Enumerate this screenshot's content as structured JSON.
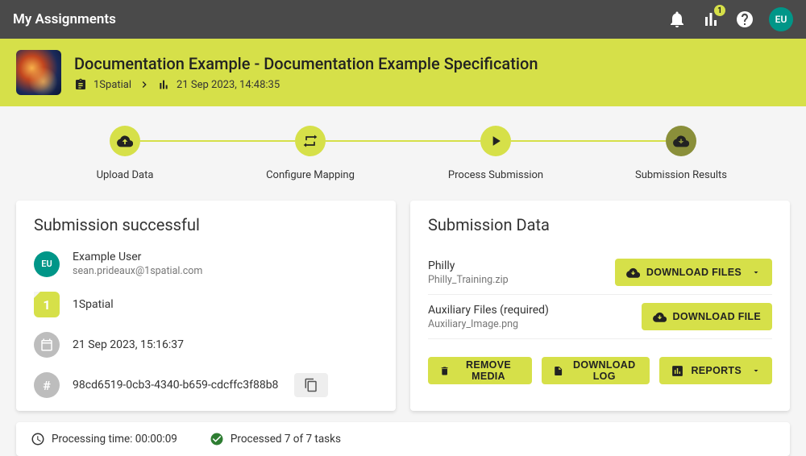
{
  "topbar": {
    "title": "My Assignments",
    "badge_count": "1",
    "avatar_initials": "EU"
  },
  "header": {
    "title": "Documentation Example - Documentation Example Specification",
    "org": "1Spatial",
    "timestamp": "21 Sep 2023, 14:48:35"
  },
  "stepper": {
    "steps": [
      {
        "label": "Upload Data"
      },
      {
        "label": "Configure Mapping"
      },
      {
        "label": "Process Submission"
      },
      {
        "label": "Submission Results"
      }
    ]
  },
  "left": {
    "heading": "Submission successful",
    "user": {
      "initials": "EU",
      "name": "Example User",
      "email": "sean.prideaux@1spatial.com"
    },
    "org": {
      "name": "1Spatial",
      "brand_char": "1"
    },
    "date": "21 Sep 2023, 15:16:37",
    "hash": "98cd6519-0cb3-4340-b659-cdcffc3f88b8"
  },
  "right": {
    "heading": "Submission Data",
    "rows": [
      {
        "label": "Philly",
        "sub": "Philly_Training.zip",
        "button": "DOWNLOAD FILES",
        "has_caret": true
      },
      {
        "label": "Auxiliary Files (required)",
        "sub": "Auxiliary_Image.png",
        "button": "DOWNLOAD FILE",
        "has_caret": false
      }
    ],
    "actions": {
      "remove": "REMOVE MEDIA",
      "log": "DOWNLOAD LOG",
      "reports": "REPORTS"
    }
  },
  "footer": {
    "processing": "Processing time: 00:00:09",
    "tasks": "Processed 7 of 7 tasks"
  }
}
